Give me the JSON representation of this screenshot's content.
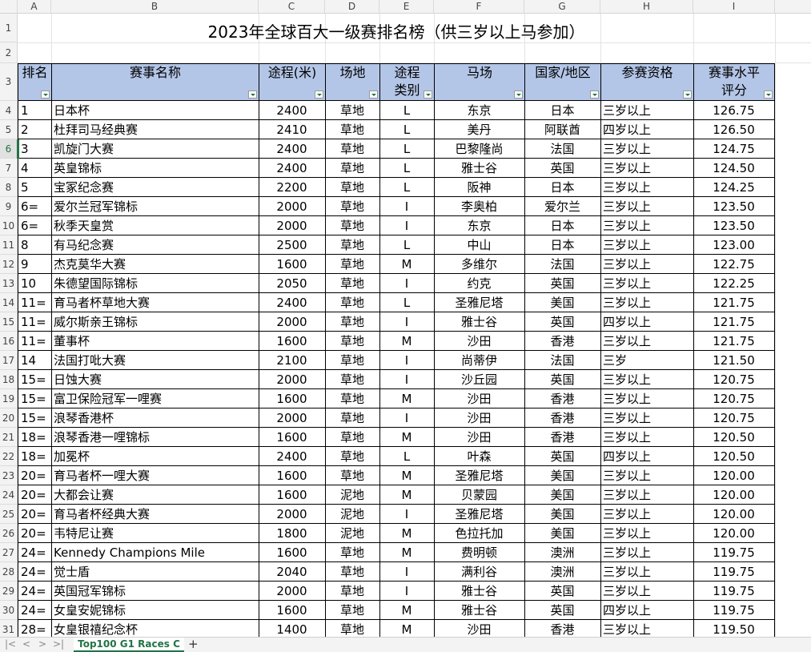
{
  "columns": [
    "A",
    "B",
    "C",
    "D",
    "E",
    "F",
    "G",
    "H",
    "I"
  ],
  "title": "2023年全球百大一级赛排名榜（供三岁以上马参加）",
  "row_numbers": [
    "1",
    "2",
    "3",
    "4",
    "5",
    "6",
    "7",
    "8",
    "9",
    "10",
    "11",
    "12",
    "13",
    "14",
    "15",
    "16",
    "17",
    "18",
    "19",
    "20",
    "21",
    "22",
    "23",
    "24",
    "25",
    "26",
    "27",
    "28",
    "29",
    "30",
    "31"
  ],
  "headers": {
    "rank": "排名",
    "race": "赛事名称",
    "distance": "途程(米)",
    "surface": "场地",
    "dist_type_1": "途程",
    "dist_type_2": "类别",
    "course": "马场",
    "country": "国家/地区",
    "eligibility": "参赛资格",
    "rating_1": "赛事水平",
    "rating_2": "评分"
  },
  "rows": [
    [
      "1",
      "日本杯",
      "2400",
      "草地",
      "L",
      "东京",
      "日本",
      "三岁以上",
      "126.75"
    ],
    [
      "2",
      "杜拜司马经典赛",
      "2410",
      "草地",
      "L",
      "美丹",
      "阿联酋",
      "四岁以上",
      "126.50"
    ],
    [
      "3",
      "凯旋门大赛",
      "2400",
      "草地",
      "L",
      "巴黎隆尚",
      "法国",
      "三岁以上",
      "124.75"
    ],
    [
      "4",
      "英皇锦标",
      "2400",
      "草地",
      "L",
      "雅士谷",
      "英国",
      "三岁以上",
      "124.50"
    ],
    [
      "5",
      "宝冢纪念赛",
      "2200",
      "草地",
      "L",
      "阪神",
      "日本",
      "三岁以上",
      "124.25"
    ],
    [
      "6=",
      "爱尔兰冠军锦标",
      "2000",
      "草地",
      "I",
      "李奥柏",
      "爱尔兰",
      "三岁以上",
      "123.50"
    ],
    [
      "6=",
      "秋季天皇赏",
      "2000",
      "草地",
      "I",
      "东京",
      "日本",
      "三岁以上",
      "123.50"
    ],
    [
      "8",
      "有马纪念赛",
      "2500",
      "草地",
      "L",
      "中山",
      "日本",
      "三岁以上",
      "123.00"
    ],
    [
      "9",
      "杰克莫华大赛",
      "1600",
      "草地",
      "M",
      "多维尔",
      "法国",
      "三岁以上",
      "122.75"
    ],
    [
      "10",
      "朱德望国际锦标",
      "2050",
      "草地",
      "I",
      "约克",
      "英国",
      "三岁以上",
      "122.25"
    ],
    [
      "11=",
      "育马者杯草地大赛",
      "2400",
      "草地",
      "L",
      "圣雅尼塔",
      "美国",
      "三岁以上",
      "121.75"
    ],
    [
      "11=",
      "威尔斯亲王锦标",
      "2000",
      "草地",
      "I",
      "雅士谷",
      "英国",
      "四岁以上",
      "121.75"
    ],
    [
      "11=",
      "董事杯",
      "1600",
      "草地",
      "M",
      "沙田",
      "香港",
      "三岁以上",
      "121.75"
    ],
    [
      "14",
      "法国打吡大赛",
      "2100",
      "草地",
      "I",
      "尚蒂伊",
      "法国",
      "三岁",
      "121.50"
    ],
    [
      "15=",
      "日蚀大赛",
      "2000",
      "草地",
      "I",
      "沙丘园",
      "英国",
      "三岁以上",
      "120.75"
    ],
    [
      "15=",
      "富卫保险冠军一哩赛",
      "1600",
      "草地",
      "M",
      "沙田",
      "香港",
      "三岁以上",
      "120.75"
    ],
    [
      "15=",
      "浪琴香港杯",
      "2000",
      "草地",
      "I",
      "沙田",
      "香港",
      "三岁以上",
      "120.75"
    ],
    [
      "18=",
      "浪琴香港一哩锦标",
      "1600",
      "草地",
      "M",
      "沙田",
      "香港",
      "三岁以上",
      "120.50"
    ],
    [
      "18=",
      "加冕杯",
      "2400",
      "草地",
      "L",
      "叶森",
      "英国",
      "四岁以上",
      "120.50"
    ],
    [
      "20=",
      "育马者杯一哩大赛",
      "1600",
      "草地",
      "M",
      "圣雅尼塔",
      "美国",
      "三岁以上",
      "120.00"
    ],
    [
      "20=",
      "大都会让赛",
      "1600",
      "泥地",
      "M",
      "贝蒙园",
      "美国",
      "三岁以上",
      "120.00"
    ],
    [
      "20=",
      "育马者杯经典大赛",
      "2000",
      "泥地",
      "I",
      "圣雅尼塔",
      "美国",
      "三岁以上",
      "120.00"
    ],
    [
      "20=",
      "韦特尼让赛",
      "1800",
      "泥地",
      "M",
      "色拉托加",
      "美国",
      "三岁以上",
      "120.00"
    ],
    [
      "24=",
      "Kennedy Champions Mile",
      "1600",
      "草地",
      "M",
      "费明顿",
      "澳洲",
      "三岁以上",
      "119.75"
    ],
    [
      "24=",
      "觉士盾",
      "2040",
      "草地",
      "I",
      "满利谷",
      "澳洲",
      "三岁以上",
      "119.75"
    ],
    [
      "24=",
      "英国冠军锦标",
      "2000",
      "草地",
      "I",
      "雅士谷",
      "英国",
      "三岁以上",
      "119.75"
    ],
    [
      "24=",
      "女皇安妮锦标",
      "1600",
      "草地",
      "M",
      "雅士谷",
      "英国",
      "四岁以上",
      "119.75"
    ],
    [
      "28=",
      "女皇银禧纪念杯",
      "1400",
      "草地",
      "M",
      "沙田",
      "香港",
      "三岁以上",
      "119.50"
    ]
  ],
  "sheet_tab": "Top100 G1 Races C",
  "add_tab": "+",
  "nav_first": "|<",
  "nav_prev": "<",
  "nav_next": ">",
  "nav_last": ">|"
}
